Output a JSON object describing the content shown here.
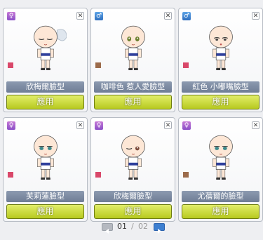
{
  "cards": [
    {
      "gender": "female",
      "gender_symbol": "♀",
      "name": "欣梅爾臉型",
      "swatch": "#d9486a",
      "apply": "應用",
      "expression": "sleepy",
      "hair": "ponytail"
    },
    {
      "gender": "male",
      "gender_symbol": "♂",
      "name": "咖啡色 惹人愛臉型",
      "swatch": "#9c6b4b",
      "apply": "應用",
      "expression": "smile",
      "hair": "none"
    },
    {
      "gender": "male",
      "gender_symbol": "♂",
      "name": "紅色 小嘟嘴臉型",
      "swatch": "#d9486a",
      "apply": "應用",
      "expression": "pout",
      "hair": "none"
    },
    {
      "gender": "female",
      "gender_symbol": "♀",
      "name": "芙莉蓮臉型",
      "swatch": "#d9486a",
      "apply": "應用",
      "expression": "calm",
      "hair": "none"
    },
    {
      "gender": "female",
      "gender_symbol": "♀",
      "name": "欣梅爾臉型",
      "swatch": "#d9486a",
      "apply": "應用",
      "expression": "wink",
      "hair": "none"
    },
    {
      "gender": "female",
      "gender_symbol": "♀",
      "name": "尤蓓爾的臉型",
      "swatch": "#9c6b4b",
      "apply": "應用",
      "expression": "calm",
      "hair": "none"
    }
  ],
  "pager": {
    "current": "01",
    "separator": "/",
    "total": "02"
  },
  "icons": {
    "close": "close-icon",
    "prev": "prev-page-icon",
    "next": "next-page-icon"
  }
}
